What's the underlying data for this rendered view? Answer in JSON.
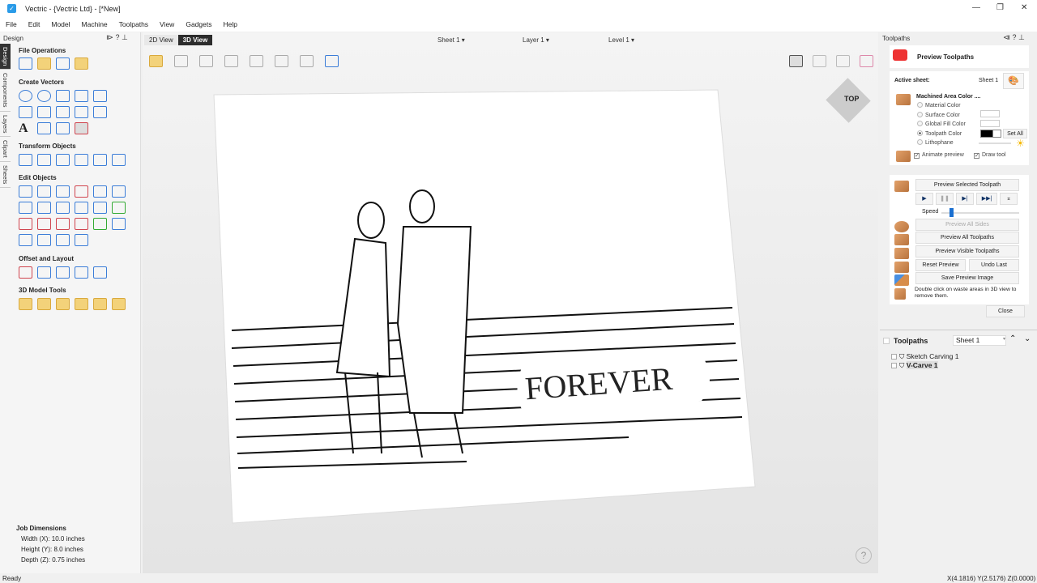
{
  "window": {
    "title": "Vectric - {Vectric Ltd} - [*New]",
    "min": "—",
    "restore": "❐",
    "close": "✕"
  },
  "menu": [
    "File",
    "Edit",
    "Model",
    "Machine",
    "Toolpaths",
    "View",
    "Gadgets",
    "Help"
  ],
  "left_panel": {
    "title": "Design",
    "tabs": [
      "Design",
      "Components",
      "Layers",
      "Clipart",
      "Sheets"
    ],
    "sections": [
      "File Operations",
      "Create Vectors",
      "Transform Objects",
      "Edit Objects",
      "Offset and Layout",
      "3D Model Tools"
    ],
    "job_dimensions": {
      "title": "Job Dimensions",
      "width": "Width  (X): 10.0 inches",
      "height": "Height (Y): 8.0 inches",
      "depth": "Depth  (Z): 0.75 inches"
    }
  },
  "view_tabs": [
    "2D View",
    "3D View"
  ],
  "toolbar": {
    "sheet": "Sheet 1 ▾",
    "layer": "Layer 1 ▾",
    "level": "Level 1 ▾"
  },
  "view_cube": "TOP",
  "artwork_text": "FOREVER",
  "right_panel": {
    "title": "Toolpaths",
    "form_title": "Preview Toolpaths",
    "active_sheet_label": "Active sheet:",
    "active_sheet": "Sheet 1",
    "machined_area": "Machined Area Color ....",
    "color_options": [
      "Material Color",
      "Surface Color",
      "Global Fill Color",
      "Toolpath Color",
      "Lithophane"
    ],
    "selected_color_option": "Toolpath Color",
    "set_all": "Set All",
    "animate_preview": "Animate preview",
    "draw_tool": "Draw tool",
    "preview_selected": "Preview Selected Toolpath",
    "speed": "Speed",
    "speed_value": 0.1,
    "preview_all_sides": "Preview All Sides",
    "preview_all": "Preview All Toolpaths",
    "preview_visible": "Preview Visible Toolpaths",
    "reset_preview": "Reset Preview",
    "undo_last": "Undo Last",
    "save_image": "Save Preview Image",
    "hint": "Double click on waste areas in 3D view to remove them.",
    "close": "Close",
    "list_title": "Toolpaths",
    "list_sheet": "Sheet 1",
    "toolpaths": [
      "Sketch Carving 1",
      "V-Carve 1"
    ]
  },
  "status": {
    "left": "Ready",
    "coords": "X(4.1816) Y(2.5176) Z(0.0000)"
  }
}
